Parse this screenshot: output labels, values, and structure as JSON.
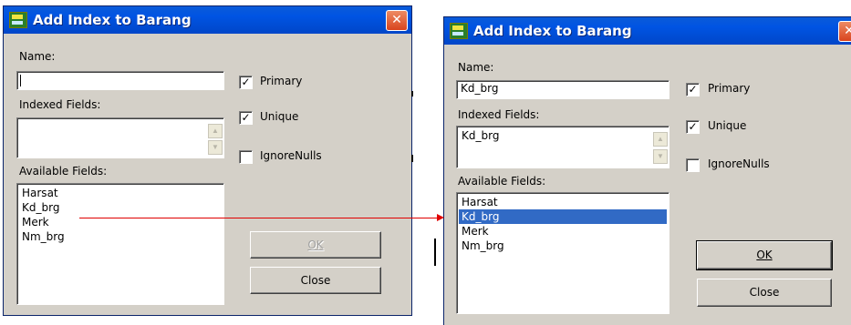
{
  "dialog_before": {
    "title": "Add Index to Barang",
    "name_label": "Name:",
    "name_value": "",
    "indexed_fields_label": "Indexed Fields:",
    "indexed_fields": [],
    "available_fields_label": "Available Fields:",
    "available_fields": [
      "Harsat",
      "Kd_brg",
      "Merk",
      "Nm_brg"
    ],
    "options": [
      {
        "label": "Primary",
        "checked": true
      },
      {
        "label": "Unique",
        "checked": true
      },
      {
        "label": "IgnoreNulls",
        "checked": false
      }
    ],
    "ok_label": "OK",
    "ok_enabled": false,
    "close_label": "Close"
  },
  "dialog_after": {
    "title": "Add Index to Barang",
    "name_label": "Name:",
    "name_value": "Kd_brg",
    "indexed_fields_label": "Indexed Fields:",
    "indexed_fields": [
      "Kd_brg"
    ],
    "available_fields_label": "Available Fields:",
    "available_fields": [
      "Harsat",
      "Kd_brg",
      "Merk",
      "Nm_brg"
    ],
    "selected_field": "Kd_brg",
    "options": [
      {
        "label": "Primary",
        "checked": true
      },
      {
        "label": "Unique",
        "checked": true
      },
      {
        "label": "IgnoreNulls",
        "checked": false
      }
    ],
    "ok_label": "OK",
    "ok_enabled": true,
    "close_label": "Close"
  },
  "glyphs": {
    "check_mark": "✓",
    "close_x": "✕",
    "arrow_up": "▲",
    "arrow_down": "▼"
  },
  "colors": {
    "title_bar": "#0054e3",
    "selection": "#316ac5",
    "annotation_arrow": "#e00000"
  }
}
